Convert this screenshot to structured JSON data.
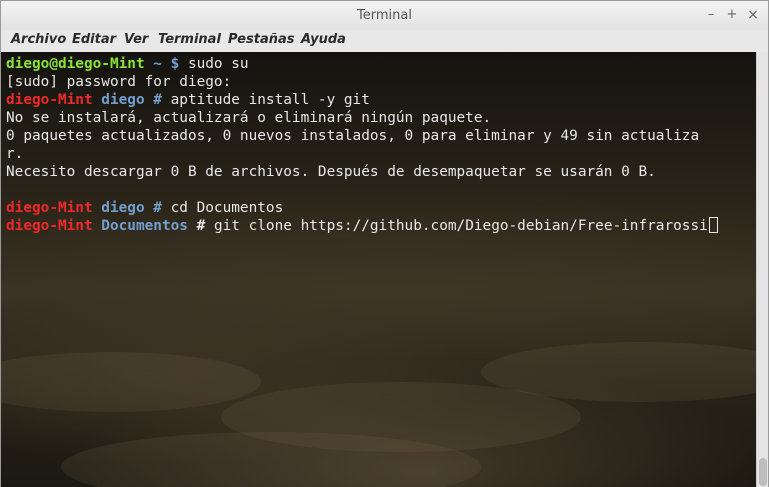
{
  "window": {
    "title": "Terminal",
    "minimize": "–",
    "maximize": "+",
    "close": "×"
  },
  "menu": [
    "Archivo",
    "Editar",
    "Ver",
    "Terminal",
    "Pestañas",
    "Ayuda"
  ],
  "terminal": {
    "line1": {
      "user": "diego@diego-Mint",
      "path": " ~ $",
      "cmd": " sudo su"
    },
    "line2": "[sudo] password for diego:",
    "line3": {
      "host": "diego-Mint",
      "dir": " diego",
      "hash": " #",
      "cmd": " aptitude install -y git"
    },
    "line4": "No se instalará, actualizará o eliminará ningún paquete.",
    "line5": "0 paquetes actualizados, 0 nuevos instalados, 0 para eliminar y 49 sin actualiza",
    "line6": "r.",
    "line7": "Necesito descargar 0 B de archivos. Después de desempaquetar se usarán 0 B.",
    "line8": {
      "host": "diego-Mint",
      "dir": " diego",
      "hash": " #",
      "cmd": " cd Documentos"
    },
    "line9": {
      "host": "diego-Mint",
      "dir": " Documentos",
      "hash": " #",
      "cmd": " git clone https://github.com/Diego-debian/Free-infrarossi"
    }
  },
  "colors": {
    "user_green": "#8ae234",
    "host_red": "#ef2929",
    "dir_blue": "#729fcf",
    "text": "#e8e8e8"
  }
}
